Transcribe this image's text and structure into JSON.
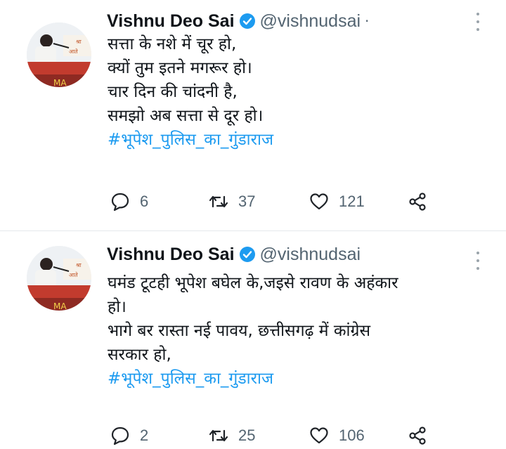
{
  "tweets": [
    {
      "author_name": "Vishnu Deo Sai",
      "handle": "@vishnudsai",
      "separator": "·",
      "lines": [
        "सत्ता के नशे में चूर हो,",
        "क्यों तुम इतने मगरूर हो।",
        "चार दिन की चांदनी है,",
        "समझो अब सत्ता से दूर हो।"
      ],
      "hashtag": "#भूपेश_पुलिस_का_गुंडाराज",
      "replies": "6",
      "retweets": "37",
      "likes": "121"
    },
    {
      "author_name": "Vishnu Deo Sai",
      "handle": "@vishnudsai",
      "lines": [
        "घमंड टूटही भूपेश बघेल के,जइसे रावण के अहंकार",
        "हो।",
        "भागे बर रास्ता नई पावय, छत्तीसगढ़ में कांग्रेस",
        "सरकार हो,"
      ],
      "hashtag": "#भूपेश_पुलिस_का_गुंडाराज",
      "replies": "2",
      "retweets": "25",
      "likes": "106"
    }
  ],
  "colors": {
    "link": "#1d9bf0",
    "verified": "#1d9bf0",
    "muted": "#536471",
    "divider": "#e5e9ec"
  },
  "icons": {
    "reply": "reply-icon",
    "retweet": "retweet-icon",
    "like": "heart-icon",
    "share": "share-icon",
    "more": "more-vertical-icon",
    "verified": "verified-badge-icon"
  }
}
